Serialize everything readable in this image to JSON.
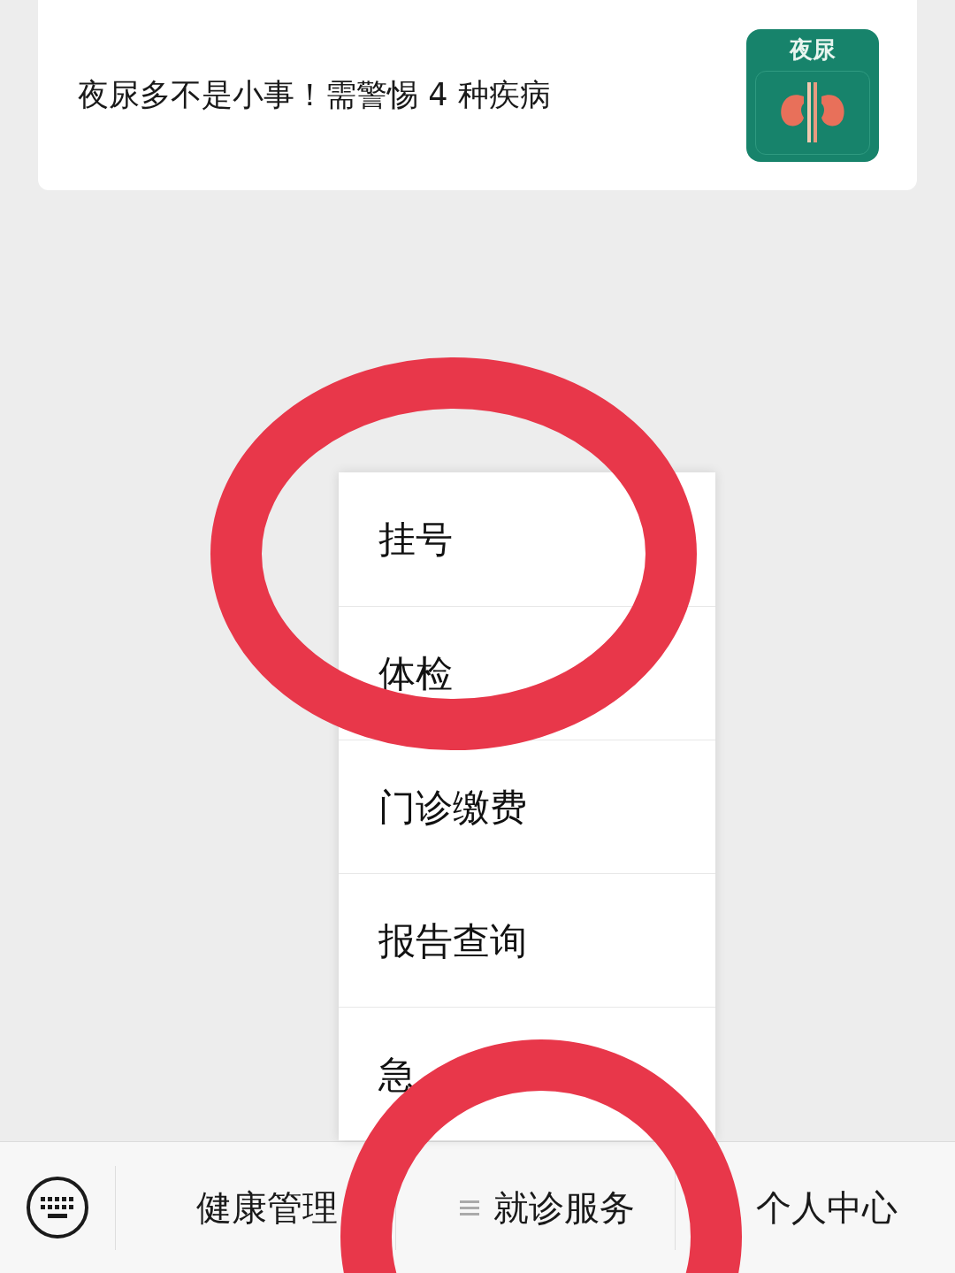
{
  "article": {
    "title": "夜尿多不是小事！需警惕 4 种疾病",
    "thumbnail_label": "夜尿"
  },
  "popup_menu": {
    "items": [
      {
        "label": "挂号"
      },
      {
        "label": "体检"
      },
      {
        "label": "门诊缴费"
      },
      {
        "label": "报告查询"
      },
      {
        "label": "急"
      }
    ]
  },
  "bottom_menu": {
    "tabs": [
      {
        "label": "健康管理",
        "menu_icon": false
      },
      {
        "label": "就诊服务",
        "menu_icon": true
      },
      {
        "label": "个人中心",
        "menu_icon": false
      }
    ]
  }
}
